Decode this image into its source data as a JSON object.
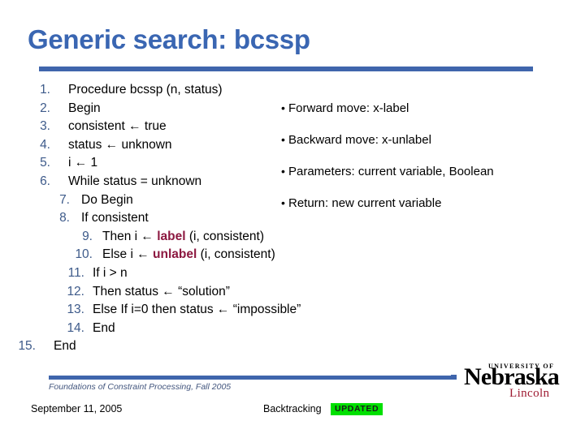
{
  "slide": {
    "title": "Generic search: bcssp",
    "accent_color": "#3f65ac",
    "title_color": "#3a66b2",
    "number_color": "#3d5a8a",
    "keyword_color": "#8c1840",
    "badge_color": "#00e000"
  },
  "code": {
    "lines": [
      {
        "num": "1.",
        "level": 0,
        "parts": [
          {
            "t": "Procedure bcssp (n, status)",
            "style": "plain"
          }
        ]
      },
      {
        "num": "2.",
        "level": 0,
        "parts": [
          {
            "t": "Begin",
            "style": "plain"
          }
        ]
      },
      {
        "num": "3.",
        "level": 0,
        "parts": [
          {
            "t": "consistent ← true",
            "style": "plain"
          }
        ]
      },
      {
        "num": "4.",
        "level": 0,
        "parts": [
          {
            "t": "status ← unknown",
            "style": "plain"
          }
        ]
      },
      {
        "num": "5.",
        "level": 0,
        "parts": [
          {
            "t": "i ← 1",
            "style": "plain"
          }
        ]
      },
      {
        "num": "6.",
        "level": 0,
        "parts": [
          {
            "t": "While status = unknown",
            "style": "plain"
          }
        ]
      },
      {
        "num": "7.",
        "level": 1,
        "parts": [
          {
            "t": "Do Begin",
            "style": "plain"
          }
        ]
      },
      {
        "num": "8.",
        "level": 1,
        "parts": [
          {
            "t": "If consistent",
            "style": "plain"
          }
        ]
      },
      {
        "num": "9.",
        "level": 2,
        "parts": [
          {
            "t": "Then i ← ",
            "style": "plain"
          },
          {
            "t": "label",
            "style": "kw"
          },
          {
            "t": " (i, consistent)",
            "style": "plain"
          }
        ]
      },
      {
        "num": "10.",
        "level": 2,
        "parts": [
          {
            "t": "Else  i ← ",
            "style": "plain"
          },
          {
            "t": "unlabel",
            "style": "kw"
          },
          {
            "t": " (i, consistent)",
            "style": "plain"
          }
        ]
      },
      {
        "num": "11.",
        "level": 3,
        "parts": [
          {
            "t": "If i > n",
            "style": "plain"
          }
        ]
      },
      {
        "num": "12.",
        "level": 3,
        "parts": [
          {
            "t": "Then status ← “solution”",
            "style": "plain"
          }
        ]
      },
      {
        "num": "13.",
        "level": 3,
        "parts": [
          {
            "t": "Else If i=0 then status ← “impossible”",
            "style": "plain"
          }
        ]
      },
      {
        "num": "14.",
        "level": 3,
        "parts": [
          {
            "t": "End",
            "style": "plain"
          }
        ]
      },
      {
        "num": "15.",
        "level": 4,
        "parts": [
          {
            "t": "End",
            "style": "plain"
          }
        ]
      }
    ]
  },
  "bullets": {
    "marker": "•",
    "items": [
      "Forward move: x-label",
      "Backward move: x-unlabel",
      "Parameters: current variable, Boolean",
      "Return: new current variable"
    ]
  },
  "footer": {
    "course": "Foundations of Constraint Processing, Fall 2005",
    "date": "September 11, 2005",
    "topic": "Backtracking",
    "badge": "UPDATED"
  },
  "logo": {
    "small": "UNIVERSITY OF",
    "main": "Nebraska",
    "sub": "Lincoln"
  }
}
